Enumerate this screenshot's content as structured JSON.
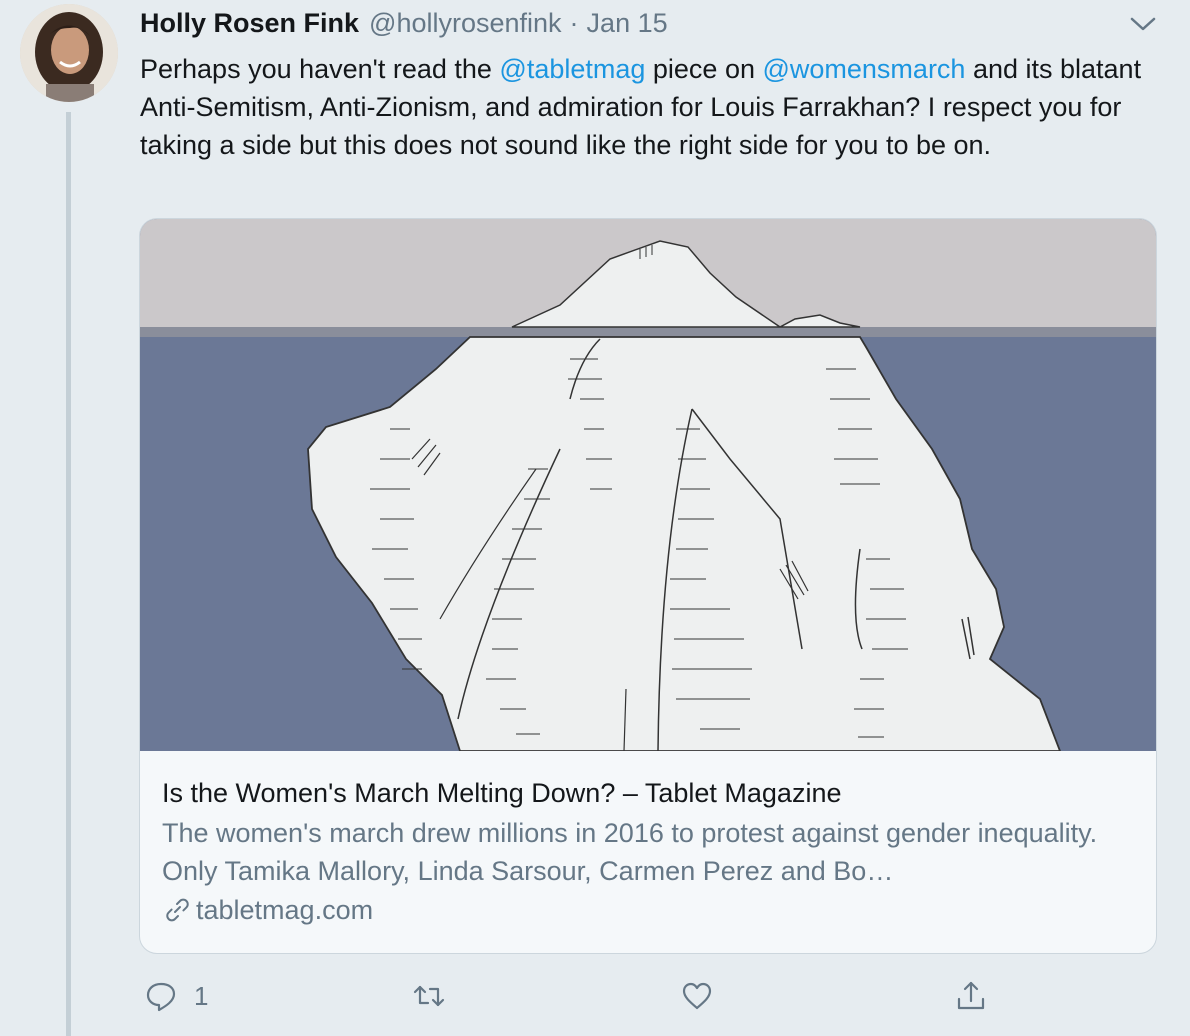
{
  "tweet": {
    "author_name": "Holly Rosen Fink",
    "handle": "@hollyrosenfink",
    "separator": "·",
    "date": "Jan 15",
    "text_segments": {
      "t1": "Perhaps you haven't read the ",
      "m1": "@tabletmag",
      "t2": " piece on ",
      "m2": "@womensmarch",
      "t3": " and its blatant Anti-Semitism, Anti-Zionism, and admiration for Louis Farrakhan? I respect you for taking a side but this does not sound like the right side for you to be on."
    }
  },
  "card": {
    "title": "Is the Women's March Melting Down? – Tablet Magazine",
    "description": "The women's march drew millions in 2016 to protest against gender inequality. Only Tamika Mallory, Linda Sarsour, Carmen Perez and Bo…",
    "domain": "tabletmag.com",
    "image": "iceberg-illustration"
  },
  "actions": {
    "reply_count": "1"
  },
  "colors": {
    "accent": "#1b95e0",
    "secondary_text": "#657786",
    "background": "#e6ecf0",
    "card_background": "#f5f8fa",
    "water": "#6b7896",
    "sky": "#cbc8ca"
  },
  "icons": [
    "caret-down-icon",
    "link-icon",
    "reply-icon",
    "retweet-icon",
    "like-icon",
    "share-icon"
  ]
}
